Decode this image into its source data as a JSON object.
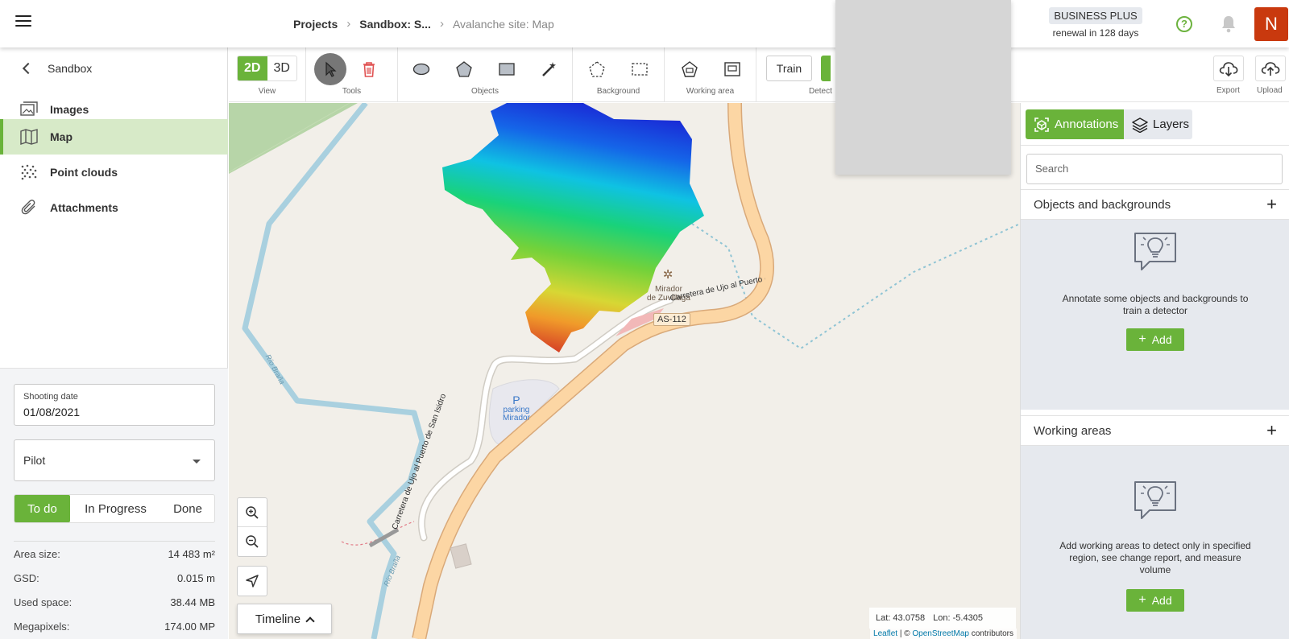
{
  "header": {
    "breadcrumbs": [
      "Projects",
      "Sandbox: S...",
      "Avalanche site: Map"
    ],
    "plan_badge": "BUSINESS PLUS",
    "plan_renewal": "renewal in 128 days",
    "help_glyph": "?",
    "avatar_initial": "N",
    "colors": {
      "accent": "#6ab33a",
      "avatar": "#c9390e"
    }
  },
  "sidebar": {
    "back_label": "Sandbox",
    "items": [
      {
        "label": "Images",
        "icon": "images-icon",
        "active": false
      },
      {
        "label": "Map",
        "icon": "map-icon",
        "active": true
      },
      {
        "label": "Point clouds",
        "icon": "point-cloud-icon",
        "active": false
      },
      {
        "label": "Attachments",
        "icon": "paperclip-icon",
        "active": false
      }
    ],
    "shooting_date_label": "Shooting date",
    "shooting_date_value": "01/08/2021",
    "pilot_placeholder": "Pilot",
    "status_options": [
      "To do",
      "In Progress",
      "Done"
    ],
    "status_selected": "To do",
    "stats": [
      {
        "label": "Area size:",
        "value": "14 483 m²"
      },
      {
        "label": "GSD:",
        "value": "0.015 m"
      },
      {
        "label": "Used space:",
        "value": "38.44 MB"
      },
      {
        "label": "Megapixels:",
        "value": "174.00 MP"
      }
    ]
  },
  "toolbar": {
    "view_2d": "2D",
    "view_3d": "3D",
    "group_labels": {
      "view": "View",
      "tools": "Tools",
      "objects": "Objects",
      "background": "Background",
      "working_area": "Working area",
      "detect": "Detect",
      "export": "Export",
      "upload": "Upload"
    },
    "train_label": "Train"
  },
  "map": {
    "labels": {
      "mirador_line1": "Mirador",
      "mirador_line2": "de Zuvillaga",
      "road_shield": "AS-112",
      "road_name": "Carretera de Ujo al Puerto de San Isidro",
      "parking_symbol": "P",
      "parking_line1": "parking",
      "parking_line2": "Mirador",
      "river": "Río Braña"
    },
    "timeline_label": "Timeline",
    "lat": "Lat: 43.0758",
    "lon": "Lon: -5.4305",
    "attribution_leaflet": "Leaflet",
    "attribution_sep": " | © ",
    "attribution_osm": "OpenStreetMap",
    "attribution_tail": " contributors"
  },
  "panel": {
    "tab_annotations": "Annotations",
    "tab_layers": "Layers",
    "search_placeholder": "Search",
    "section1_title": "Objects and backgrounds",
    "section1_text": "Annotate some objects and backgrounds to train a detector",
    "section2_title": "Working areas",
    "section2_text": "Add working areas to detect only in specified region, see change report, and measure volume",
    "add_label": "Add",
    "plus_glyph": "+"
  }
}
